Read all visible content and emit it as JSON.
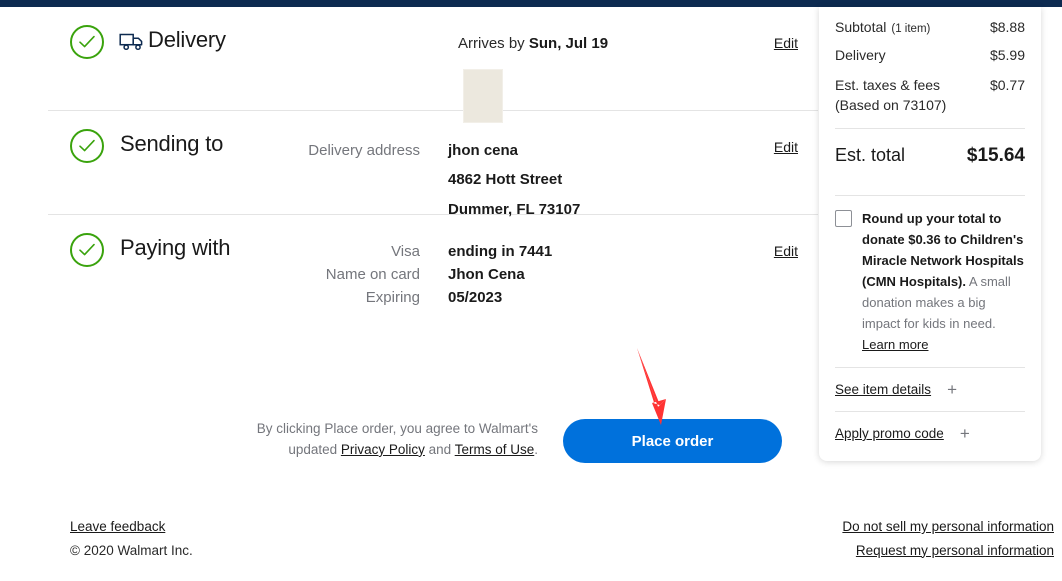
{
  "brand": {
    "accent_blue": "#0071dc",
    "navy": "#0d2a50",
    "check_green": "#3aa30d",
    "annotation_red": "#ff3333"
  },
  "sections": {
    "delivery": {
      "title": "Delivery",
      "icon": "truck-icon",
      "arrives_prefix": "Arrives by ",
      "arrives_date": "Sun, Jul 19",
      "edit_label": "Edit"
    },
    "sending_to": {
      "title": "Sending to",
      "address_label": "Delivery address",
      "name": "jhon cena",
      "street": "4862 Hott Street",
      "city_state_zip": "Dummer, FL 73107",
      "edit_label": "Edit"
    },
    "paying_with": {
      "title": "Paying with",
      "card_type_label": "Visa",
      "card_ending": "ending in 7441",
      "name_label": "Name on card",
      "name_value": "Jhon Cena",
      "expiring_label": "Expiring",
      "expiring_value": "05/2023",
      "edit_label": "Edit"
    }
  },
  "order_action": {
    "terms_prefix": "By clicking Place order, you agree to Walmart's updated ",
    "privacy_policy": "Privacy Policy",
    "terms_conjunction": " and ",
    "terms_of_use": "Terms of Use",
    "terms_suffix": ".",
    "place_order_label": "Place order"
  },
  "summary": {
    "rows": [
      {
        "label": "Subtotal",
        "note": "(1 item)",
        "value": "$8.88"
      },
      {
        "label": "Delivery",
        "note": "",
        "value": "$5.99"
      },
      {
        "label": "Est. taxes & fees",
        "note": "",
        "sub_label": "(Based on 73107)",
        "value": "$0.77"
      }
    ],
    "total_label": "Est. total",
    "total_value": "$15.64",
    "roundup": {
      "bold_text": "Round up your total to donate $0.36 to Children's Miracle Network Hospitals (CMN Hospitals).",
      "regular_text": " A small donation makes a big impact for kids in need. ",
      "learn_more": "Learn more",
      "checked": false
    },
    "expanders": [
      {
        "label": "See item details",
        "icon": "plus-icon"
      },
      {
        "label": "Apply promo code",
        "icon": "plus-icon"
      }
    ]
  },
  "footer": {
    "leave_feedback": "Leave feedback",
    "copyright": "© 2020 Walmart Inc.",
    "do_not_sell": "Do not sell my personal information",
    "request_info": "Request my personal information"
  }
}
